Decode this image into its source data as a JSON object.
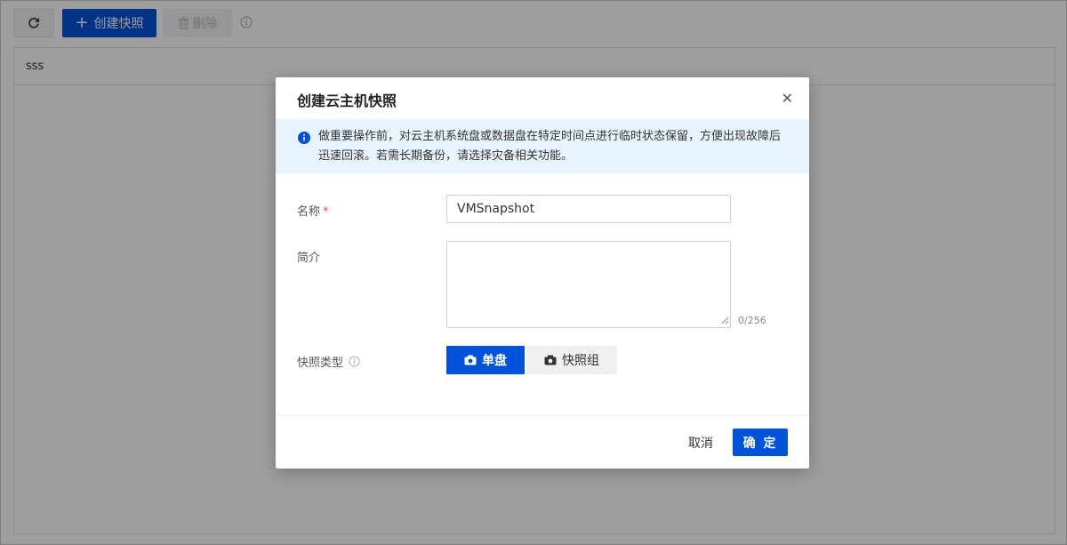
{
  "toolbar": {
    "refresh_icon": "refresh-icon",
    "create_label": "创建快照",
    "delete_label": "删除",
    "info_icon": "info-icon"
  },
  "table": {
    "header_cell": "sss"
  },
  "modal": {
    "title": "创建云主机快照",
    "close_icon": "close-icon",
    "notice_text": "做重要操作前，对云主机系统盘或数据盘在特定时间点进行临时状态保留，方便出现故障后迅速回滚。若需长期备份，请选择灾备相关功能。",
    "name_label": "名称",
    "required_mark": "*",
    "name_value": "VMSnapshot",
    "desc_label": "简介",
    "desc_value": "",
    "desc_counter": "0/256",
    "type_label": "快照类型",
    "type_options": [
      "单盘",
      "快照组"
    ],
    "type_selected": "单盘",
    "cancel_label": "取消",
    "confirm_label": "确 定"
  },
  "colors": {
    "primary": "#0052d9",
    "notice_bg": "#e8f4fd",
    "required": "#e34d59"
  }
}
